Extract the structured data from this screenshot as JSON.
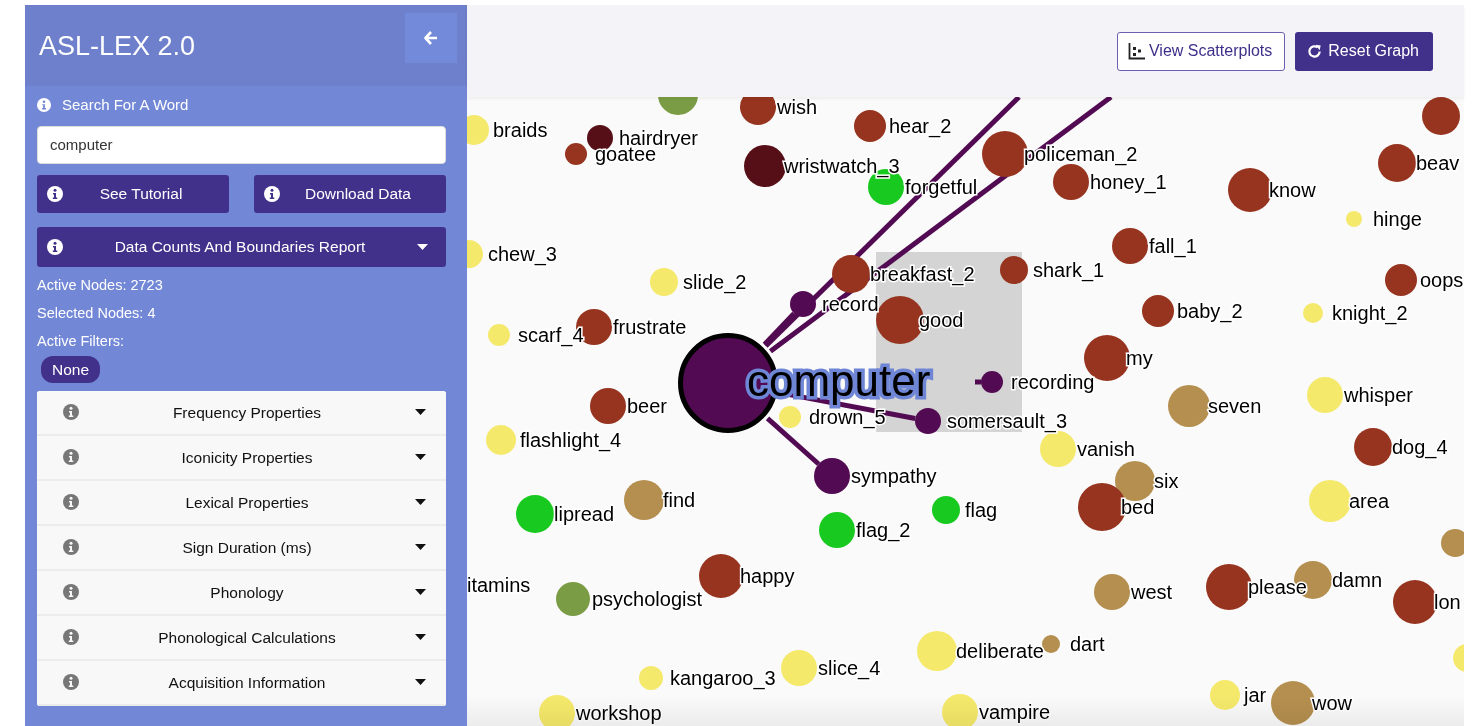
{
  "sidebar": {
    "title": "ASL-LEX 2.0",
    "search": {
      "label": "Search For A Word",
      "value": "computer"
    },
    "buttons": [
      {
        "label": "See Tutorial"
      },
      {
        "label": "Download Data"
      }
    ],
    "report_button": {
      "label": "Data Counts And Boundaries Report",
      "expanded": false
    },
    "stats": [
      "Active Nodes: 2723",
      "Selected Nodes: 4",
      "Active Filters:"
    ],
    "filter_badges": [
      "None"
    ],
    "filter_groups": [
      {
        "label": "Frequency Properties",
        "expanded": false
      },
      {
        "label": "Iconicity Properties",
        "expanded": false
      },
      {
        "label": "Lexical Properties",
        "expanded": false
      },
      {
        "label": "Sign Duration (ms)",
        "expanded": false
      },
      {
        "label": "Phonology",
        "expanded": false
      },
      {
        "label": "Phonological Calculations",
        "expanded": false
      },
      {
        "label": "Acquisition Information",
        "expanded": false
      }
    ]
  },
  "toolbar": {
    "buttons": [
      {
        "label": "View Scatterplots",
        "kind": "outline"
      },
      {
        "label": "Reset Graph",
        "kind": "solid"
      }
    ]
  },
  "graph": {
    "nodes": [
      {
        "color": "#7a9c45",
        "selected": false
      },
      {
        "label": "wish",
        "color": "#96341f",
        "selected": false
      },
      {
        "label": "braids",
        "color": "#f5e96b",
        "selected": false
      },
      {
        "label": "hairdryer",
        "color": "#560f17",
        "selected": false
      },
      {
        "label": "goatee",
        "color": "#96341f",
        "selected": false
      },
      {
        "label": "hear_2",
        "color": "#96341f",
        "selected": false
      },
      {
        "label": "wristwatch_3",
        "color": "#560f17",
        "selected": false
      },
      {
        "label": "forgetful",
        "color": "#18c91f",
        "selected": false
      },
      {
        "label": "policeman_2",
        "color": "#96341f",
        "selected": false
      },
      {
        "label": "honey_1",
        "color": "#96341f",
        "selected": false
      },
      {
        "label": "know",
        "color": "#96341f",
        "selected": false
      },
      {
        "color": "#96341f",
        "selected": false
      },
      {
        "label": "beav",
        "color": "#96341f",
        "selected": false
      },
      {
        "label": "hinge",
        "color": "#f5e96b",
        "selected": false
      },
      {
        "label": "chew_3",
        "color": "#f5e96b",
        "selected": false
      },
      {
        "label": "slide_2",
        "color": "#f5e96b",
        "selected": false
      },
      {
        "label": "breakfast_2",
        "color": "#96341f",
        "selected": false
      },
      {
        "label": "shark_1",
        "color": "#96341f",
        "selected": false
      },
      {
        "label": "fall_1",
        "color": "#96341f",
        "selected": false
      },
      {
        "label": "oops",
        "color": "#96341f",
        "selected": false
      },
      {
        "label": "record",
        "color": "#520a52",
        "selected": false
      },
      {
        "label": "good",
        "color": "#96341f",
        "selected": false
      },
      {
        "label": "baby_2",
        "color": "#96341f",
        "selected": false
      },
      {
        "label": "knight_2",
        "color": "#f5e96b",
        "selected": false
      },
      {
        "label": "scarf_4",
        "color": "#f5e96b",
        "selected": false
      },
      {
        "label": "frustrate",
        "color": "#96341f",
        "selected": false
      },
      {
        "label": "computer",
        "color": "#520a52",
        "selected": true
      },
      {
        "label": "my",
        "color": "#96341f",
        "selected": false
      },
      {
        "label": "recording",
        "color": "#520a52",
        "selected": false
      },
      {
        "label": "beer",
        "color": "#96341f",
        "selected": false
      },
      {
        "label": "drown_5",
        "color": "#f5e96b",
        "selected": false
      },
      {
        "label": "somersault_3",
        "color": "#520a52",
        "selected": false
      },
      {
        "label": "seven",
        "color": "#b58f4f",
        "selected": false
      },
      {
        "label": "whisper",
        "color": "#f5e96b",
        "selected": false
      },
      {
        "label": "flashlight_4",
        "color": "#f5e96b",
        "selected": false
      },
      {
        "label": "vanish",
        "color": "#f5e96b",
        "selected": false
      },
      {
        "label": "dog_4",
        "color": "#96341f",
        "selected": false
      },
      {
        "label": "sympathy",
        "color": "#520a52",
        "selected": false
      },
      {
        "label": "six",
        "color": "#b58f4f",
        "selected": false
      },
      {
        "label": "find",
        "color": "#b58f4f",
        "selected": false
      },
      {
        "label": "lipread",
        "color": "#18c91f",
        "selected": false
      },
      {
        "label": "flag",
        "color": "#18c91f",
        "selected": false
      },
      {
        "label": "bed",
        "color": "#96341f",
        "selected": false
      },
      {
        "label": "area",
        "color": "#f5e96b",
        "selected": false
      },
      {
        "label": "flag_2",
        "color": "#18c91f",
        "selected": false
      },
      {
        "color": "#b58f4f",
        "selected": false
      },
      {
        "label": "itamins",
        "selected": false
      },
      {
        "label": "happy",
        "color": "#96341f",
        "selected": false
      },
      {
        "label": "psychologist",
        "color": "#7a9c45",
        "selected": false
      },
      {
        "label": "west",
        "color": "#b58f4f",
        "selected": false
      },
      {
        "label": "please",
        "color": "#96341f",
        "selected": false
      },
      {
        "label": "damn",
        "color": "#b58f4f",
        "selected": false
      },
      {
        "label": "lon",
        "color": "#96341f",
        "selected": false
      },
      {
        "label": "deliberate",
        "color": "#f5e96b",
        "selected": false
      },
      {
        "label": "dart",
        "color": "#b58f4f",
        "selected": false
      },
      {
        "label": "kangaroo_3",
        "color": "#f5e96b",
        "selected": false
      },
      {
        "label": "slice_4",
        "color": "#f5e96b",
        "selected": false
      },
      {
        "color": "#f5e96b",
        "selected": false
      },
      {
        "label": "jar",
        "color": "#f5e96b",
        "selected": false
      },
      {
        "label": "wow",
        "color": "#b58f4f",
        "selected": false
      },
      {
        "label": "workshop",
        "color": "#f5e96b",
        "selected": false
      },
      {
        "label": "vampire",
        "color": "#f5e96b",
        "selected": false
      }
    ]
  }
}
